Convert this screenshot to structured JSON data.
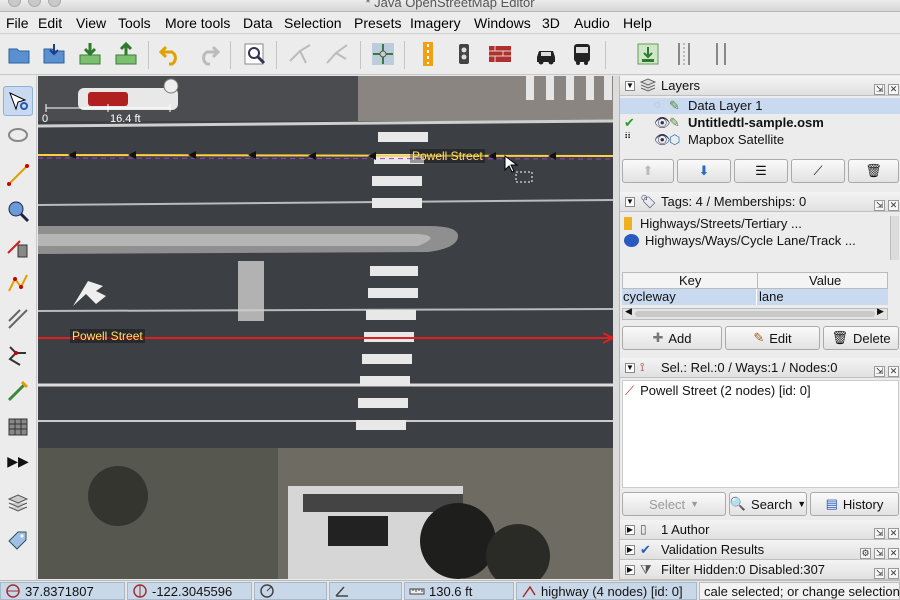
{
  "window": {
    "title": "* Java OpenStreetMap Editor"
  },
  "menu": [
    "File",
    "Edit",
    "View",
    "Tools",
    "More tools",
    "Data",
    "Selection",
    "Presets",
    "Imagery",
    "Windows",
    "3D",
    "Audio",
    "Help"
  ],
  "toolbar": {
    "icons": [
      "open-icon",
      "download-icon",
      "download-data-icon",
      "upload-icon",
      "undo-icon",
      "redo-icon",
      "zoom-preview-icon",
      "split-way-icon",
      "combine-way-icon",
      "move-node-icon",
      "traffic-lights-icon",
      "barrier-icon",
      "car-icon",
      "bus-icon",
      "save-as-icon",
      "column-icon",
      "double-column-icon"
    ]
  },
  "map": {
    "scale_zero": "0",
    "scale_value": "16.4 ft",
    "street_label_top": "Powell Street",
    "street_label_bottom": "Powell Street"
  },
  "layers": {
    "title": "Layers",
    "items": [
      {
        "name": "Data Layer 1",
        "bold": false
      },
      {
        "name": "Untitledtl-sample.osm",
        "bold": true
      },
      {
        "name": "Mapbox Satellite",
        "bold": false
      }
    ]
  },
  "tags": {
    "title": "Tags: 4 / Memberships: 0",
    "presets": [
      "Highways/Streets/Tertiary ...",
      "Highways/Ways/Cycle Lane/Track ..."
    ],
    "col_key": "Key",
    "col_value": "Value",
    "rows": [
      {
        "key": "cycleway",
        "value": "lane"
      }
    ],
    "add_label": "Add",
    "edit_label": "Edit",
    "delete_label": "Delete"
  },
  "selection": {
    "title": "Sel.: Rel.:0 / Ways:1 / Nodes:0",
    "item": "Powell Street (2 nodes) [id: 0]",
    "select_label": "Select",
    "search_label": "Search",
    "history_label": "History"
  },
  "collapsed_panels": [
    "1 Author",
    "Validation Results",
    "Filter Hidden:0 Disabled:307"
  ],
  "status": {
    "lat": "37.8371807",
    "lon": "-122.3045596",
    "heading": "",
    "angle": "",
    "distance": "130.6 ft",
    "way": "highway (4 nodes) [id: 0]",
    "help": "cale selected; or change selection"
  },
  "colors": {
    "selected_way": "#e02020",
    "way": "#ffd040",
    "selection_bg": "#c9daf0"
  }
}
